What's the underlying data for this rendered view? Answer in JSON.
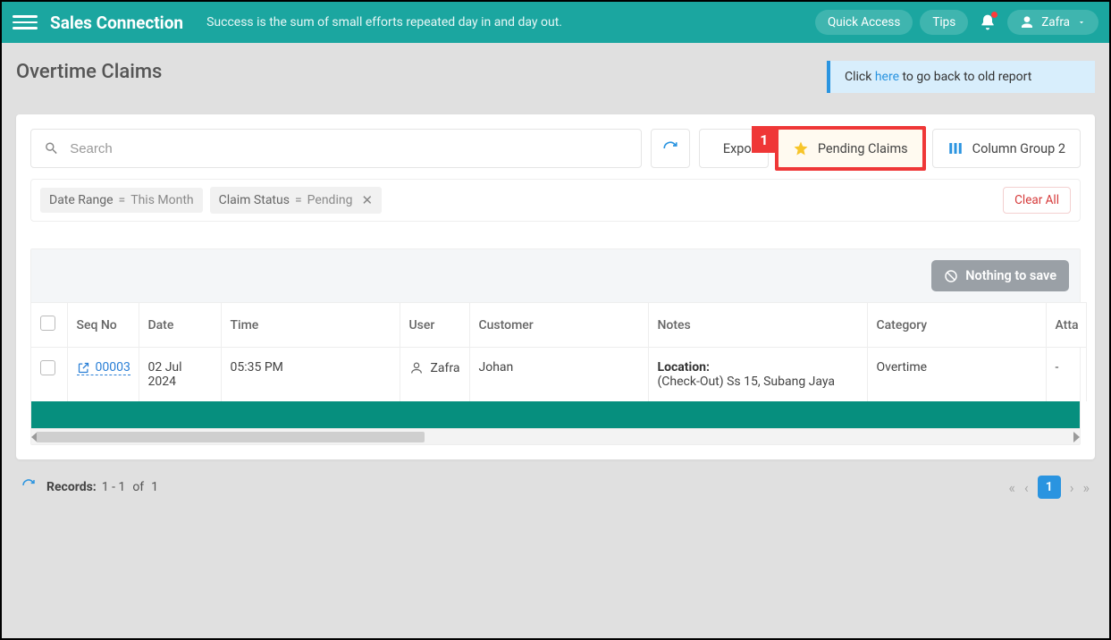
{
  "topbar": {
    "brand": "Sales Connection",
    "tagline": "Success is the sum of small efforts repeated day in and day out.",
    "quick_access": "Quick Access",
    "tips": "Tips",
    "user_name": "Zafra"
  },
  "page": {
    "title": "Overtime Claims",
    "notice_prefix": "Click ",
    "notice_link": "here",
    "notice_suffix": " to go back to old report"
  },
  "toolbar": {
    "search_placeholder": "Search",
    "export_label": "Export",
    "pending_label": "Pending Claims",
    "columns_label": "Column Group 2"
  },
  "annotation": {
    "step_number": "1"
  },
  "filters": {
    "date_range": {
      "label": "Date Range",
      "value": "This Month"
    },
    "claim_status": {
      "label": "Claim Status",
      "value": "Pending"
    },
    "clear_all": "Clear All"
  },
  "table": {
    "nothing_label": "Nothing to save",
    "columns": {
      "seq": "Seq No",
      "date": "Date",
      "time": "Time",
      "user": "User",
      "customer": "Customer",
      "notes": "Notes",
      "category": "Category",
      "attachment": "Atta"
    },
    "row": {
      "seq": "00003",
      "date": "02 Jul 2024",
      "time": "05:35 PM",
      "user": "Zafra",
      "customer": "Johan",
      "notes_label": "Location:",
      "notes_value": "(Check-Out) Ss 15, Subang Jaya",
      "category": "Overtime",
      "attachment": "-"
    }
  },
  "footer": {
    "records_label": "Records:",
    "range": "1 - 1",
    "of_label": "of",
    "total": "1",
    "current_page": "1"
  }
}
